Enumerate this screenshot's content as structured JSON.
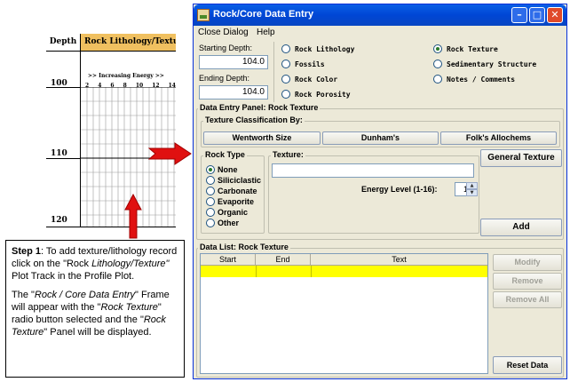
{
  "plot": {
    "depth_header": "Depth",
    "litho_header": "Rock Lithology/Texture",
    "energy_label": ">> Increasing Energy >>",
    "ticks": [
      "2",
      "4",
      "6",
      "8",
      "10",
      "12",
      "14"
    ],
    "depths": [
      "100",
      "110",
      "120"
    ]
  },
  "step": {
    "step_label": "Step 1",
    "text_a": ": To add texture/lithology record click on the \"Rock ",
    "text_b": "Lithology/Texture\"",
    "text_c": " Plot Track in the Profile Plot.",
    "p2_a": "The \"",
    "p2_b": "Rock / Core Data Entry",
    "p2_c": "\" Frame will appear with the \"",
    "p2_d": "Rock Texture",
    "p2_e": "\" radio button selected and the \"",
    "p2_f": "Rock Texture",
    "p2_g": "\" Panel will be displayed."
  },
  "window": {
    "title": "Rock/Core Data Entry",
    "minimize": "–",
    "maximize": "□",
    "close": "✕"
  },
  "menu": {
    "close_dialog": "Close Dialog",
    "help": "Help"
  },
  "depth_panel": {
    "starting_label": "Starting Depth:",
    "starting_value": "104.0",
    "ending_label": "Ending Depth:",
    "ending_value": "104.0"
  },
  "panels_options": [
    {
      "label": "Rock Lithology",
      "selected": false
    },
    {
      "label": "Fossils",
      "selected": false
    },
    {
      "label": "Rock Color",
      "selected": false
    },
    {
      "label": "Rock Porosity",
      "selected": false
    },
    {
      "label": "Rock Texture",
      "selected": true
    },
    {
      "label": "Sedimentary Structure",
      "selected": false
    },
    {
      "label": "Notes / Comments",
      "selected": false
    }
  ],
  "entry_panel": {
    "title": "Data Entry Panel: Rock Texture",
    "classification_title": "Texture Classification By:",
    "wentworth": "Wentworth Size",
    "dunham": "Dunham's",
    "folk": "Folk's Allochems",
    "rock_type_title": "Rock Type",
    "rock_types": [
      {
        "label": "None",
        "selected": true
      },
      {
        "label": "Siliciclastic",
        "selected": false
      },
      {
        "label": "Carbonate",
        "selected": false
      },
      {
        "label": "Evaporite",
        "selected": false
      },
      {
        "label": "Organic",
        "selected": false
      },
      {
        "label": "Other",
        "selected": false
      }
    ],
    "texture_title": "Texture:",
    "texture_value": "",
    "energy_label": "Energy Level (1-16):",
    "energy_value": "1",
    "general_texture": "General Texture",
    "add": "Add"
  },
  "data_list": {
    "title": "Data List: Rock Texture",
    "columns": [
      "Start",
      "End",
      "Text"
    ],
    "rows": [
      {
        "start": "",
        "end": "",
        "text": ""
      }
    ],
    "modify": "Modify",
    "remove": "Remove",
    "remove_all": "Remove All",
    "reset": "Reset Data"
  },
  "colors": {
    "arrow": "#e01010",
    "litho_header": "#f0c060",
    "selected_row": "#ffff00",
    "titlebar": "#0046d5"
  }
}
